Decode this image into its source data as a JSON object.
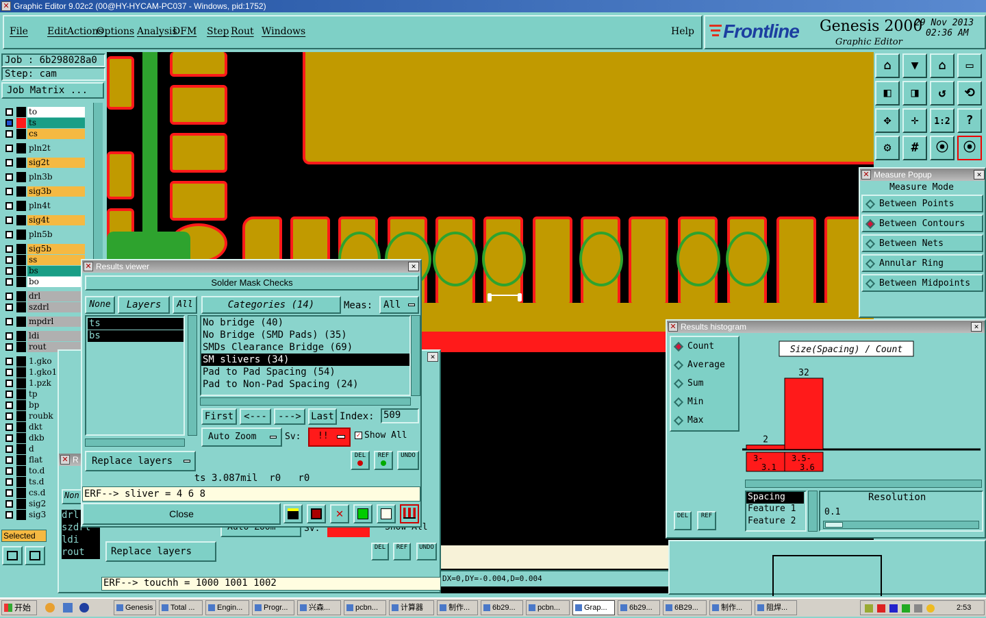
{
  "window_title": "Graphic Editor 9.02c2 (00@HY-HYCAM-PC037 - Windows, pid:1752)",
  "menu": [
    "File",
    "Edit",
    "Actions",
    "Options",
    "Analysis",
    "DFM",
    "Step",
    "Rout",
    "Windows"
  ],
  "help_label": "Help",
  "brand": {
    "logo": "Frontline",
    "product": "Genesis 2000",
    "subtitle": "Graphic Editor",
    "date": "29 Nov 2013",
    "time": "02:36 AM"
  },
  "job": {
    "job_label": "Job : 6b298028a0",
    "step_label": "Step: cam",
    "matrix_button": "Job Matrix ..."
  },
  "layers": [
    {
      "name": "to",
      "bg": "#ffffff"
    },
    {
      "name": "ts",
      "bg": "#1a9e86"
    },
    {
      "name": "cs",
      "bg": "#f5b942"
    },
    {
      "name": "pln2t",
      "bg": "#8ad4cc"
    },
    {
      "name": "sig2t",
      "bg": "#f5b942"
    },
    {
      "name": "pln3b",
      "bg": "#8ad4cc"
    },
    {
      "name": "sig3b",
      "bg": "#f5b942"
    },
    {
      "name": "pln4t",
      "bg": "#8ad4cc"
    },
    {
      "name": "sig4t",
      "bg": "#f5b942"
    },
    {
      "name": "pln5b",
      "bg": "#8ad4cc"
    },
    {
      "name": "sig5b",
      "bg": "#f5b942"
    },
    {
      "name": "ss",
      "bg": "#f5b942"
    },
    {
      "name": "bs",
      "bg": "#1a9e86"
    },
    {
      "name": "bo",
      "bg": "#ffffff"
    },
    {
      "name": "drl",
      "bg": "#b0b0b0"
    },
    {
      "name": "szdrl",
      "bg": "#b0b0b0"
    },
    {
      "name": "mpdrl",
      "bg": "#b0b0b0"
    },
    {
      "name": "ldi",
      "bg": "#b0b0b0"
    },
    {
      "name": "rout",
      "bg": "#b0b0b0"
    },
    {
      "name": "1.gko",
      "bg": "#8ad4cc"
    },
    {
      "name": "1.gko1",
      "bg": "#8ad4cc"
    },
    {
      "name": "1.pzk",
      "bg": "#8ad4cc"
    },
    {
      "name": "tp",
      "bg": "#8ad4cc"
    },
    {
      "name": "bp",
      "bg": "#8ad4cc"
    },
    {
      "name": "roubk",
      "bg": "#8ad4cc"
    },
    {
      "name": "dkt",
      "bg": "#8ad4cc"
    },
    {
      "name": "dkb",
      "bg": "#8ad4cc"
    },
    {
      "name": "d",
      "bg": "#8ad4cc"
    },
    {
      "name": "flat",
      "bg": "#8ad4cc"
    },
    {
      "name": "to.d",
      "bg": "#8ad4cc"
    },
    {
      "name": "ts.d",
      "bg": "#8ad4cc"
    },
    {
      "name": "cs.d",
      "bg": "#8ad4cc"
    },
    {
      "name": "sig2",
      "bg": "#8ad4cc"
    },
    {
      "name": "sig3",
      "bg": "#8ad4cc"
    }
  ],
  "selected_label": "Selected",
  "results_viewer": {
    "title": "Results viewer",
    "header": "Solder Mask Checks",
    "none_btn": "None",
    "layers_btn": "Layers",
    "all_btn": "All",
    "categories_btn": "Categories (14)",
    "meas_label": "Meas:",
    "meas_value": "All",
    "layer_list": [
      "ts",
      "bs"
    ],
    "categories": [
      "No bridge (40)",
      "No Bridge (SMD Pads) (35)",
      "SMDs Clearance Bridge (69)",
      "SM slivers (34)",
      "Pad to Pad Spacing (54)",
      "Pad to Non-Pad Spacing (24)"
    ],
    "first_btn": "First",
    "prev_btn": "<---",
    "next_btn": "--->",
    "last_btn": "Last",
    "index_label": "Index:",
    "index_value": "509",
    "zoom_mode": "Auto Zoom",
    "sv_label": "Sv:",
    "sv_value": "!!",
    "show_all_label": "Show All",
    "replace_layers_btn": "Replace layers",
    "del_label": "DEL",
    "ref_label": "REF",
    "undo_label": "UNDO",
    "status_line": "ts 3.087mil  r0   r0",
    "erf_line": "ERF--> sliver = 4 6 8",
    "close_btn": "Close"
  },
  "back_viewer": {
    "title": "R",
    "none_btn": "Non",
    "zoom_mode": "Auto Zoom",
    "sv_label": "Sv:",
    "show_all_label": "Show All",
    "layer_list": [
      "drl",
      "szdrl",
      "ldi",
      "rout"
    ],
    "replace_layers_btn": "Replace layers",
    "erf_line": "ERF--> touchh = 1000 1001 1002"
  },
  "coord_readout": "DX=0,DY=-0.004,D=0.004",
  "measure_popup": {
    "title": "Measure Popup",
    "header": "Measure Mode",
    "options": [
      "Between Points",
      "Between Contours",
      "Between Nets",
      "Annular Ring",
      "Between Midpoints"
    ],
    "selected_index": 1
  },
  "histogram": {
    "title": "Results histogram",
    "options": [
      "Count",
      "Average",
      "Sum",
      "Min",
      "Max"
    ],
    "selected_index": 0,
    "del_label": "DEL",
    "ref_label": "REF",
    "list_items": [
      "Spacing",
      "Feature 1",
      "Feature 2"
    ],
    "resolution_label": "Resolution",
    "resolution_value": "0.1"
  },
  "chart_data": {
    "type": "bar",
    "title": "Size(Spacing) / Count",
    "categories": [
      "3-3.1",
      "3.5-3.6"
    ],
    "tick_labels": [
      {
        "top": "3-",
        "bottom": "3.1"
      },
      {
        "top": "3.5-",
        "bottom": "3.6"
      }
    ],
    "values": [
      2,
      32
    ],
    "ylim": [
      0,
      40
    ]
  },
  "toolbar_icons": [
    "home-icon",
    "save-icon",
    "house-icon",
    "frame-icon",
    "pan-left-icon",
    "pan-right-icon",
    "flip-icon",
    "snake-icon",
    "fit-icon",
    "center-icon",
    "one-to-two-icon",
    "help-icon",
    "settings-icon",
    "grid-icon",
    "measure-icon",
    "measure-active-icon"
  ],
  "taskbar": {
    "start_label": "开始",
    "items": [
      "Genesis",
      "Total ...",
      "Engin...",
      "Progr...",
      "兴森...",
      "pcbn...",
      "计算器",
      "制作...",
      "6b29...",
      "pcbn...",
      "Grap...",
      "6b29...",
      "6B29...",
      "制作...",
      "阻焊..."
    ],
    "clock": "2:53"
  },
  "colors": {
    "ui_bg": "#8ad4cc",
    "copper": "#c19a00",
    "mask_red": "#ff1a1a",
    "green_layer": "#2ea32e",
    "selected_red": "#ff0000"
  }
}
